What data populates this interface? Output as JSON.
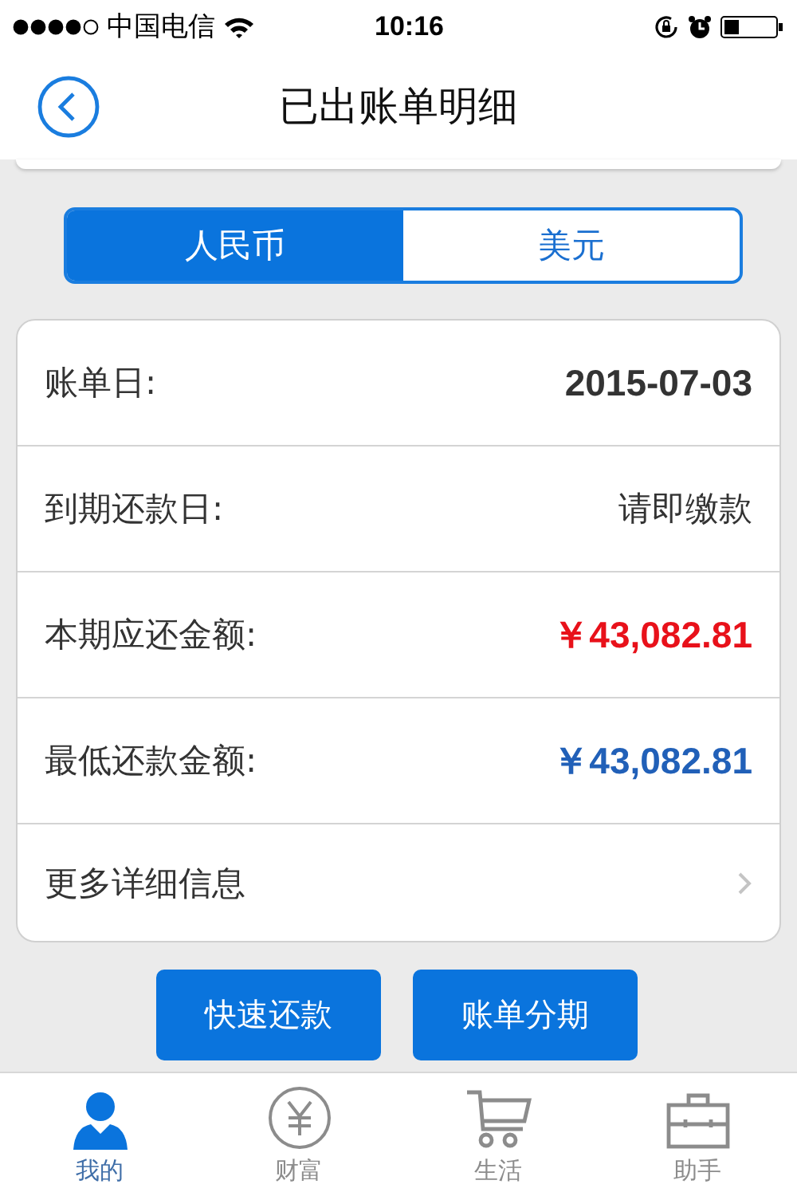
{
  "status_bar": {
    "carrier": "中国电信",
    "time": "10:16"
  },
  "nav": {
    "title": "已出账单明细"
  },
  "currency_tabs": [
    {
      "label": "人民币",
      "selected": true
    },
    {
      "label": "美元",
      "selected": false
    }
  ],
  "rows": [
    {
      "kind": "date",
      "label": "账单日:",
      "value": "2015-07-03"
    },
    {
      "kind": "text",
      "label": "到期还款日:",
      "value": "请即缴款"
    },
    {
      "kind": "due",
      "label": "本期应还金额:",
      "value": "￥43,082.81"
    },
    {
      "kind": "min",
      "label": "最低还款金额:",
      "value": "￥43,082.81"
    },
    {
      "kind": "link",
      "label": "更多详细信息"
    }
  ],
  "buttons": [
    "快速还款",
    "账单分期"
  ],
  "tab_bar": [
    {
      "label": "我的",
      "kind": "person",
      "selected": true
    },
    {
      "label": "财富",
      "kind": "yen",
      "selected": false
    },
    {
      "label": "生活",
      "kind": "cart",
      "selected": false
    },
    {
      "label": "助手",
      "kind": "briefcase",
      "selected": false
    }
  ]
}
